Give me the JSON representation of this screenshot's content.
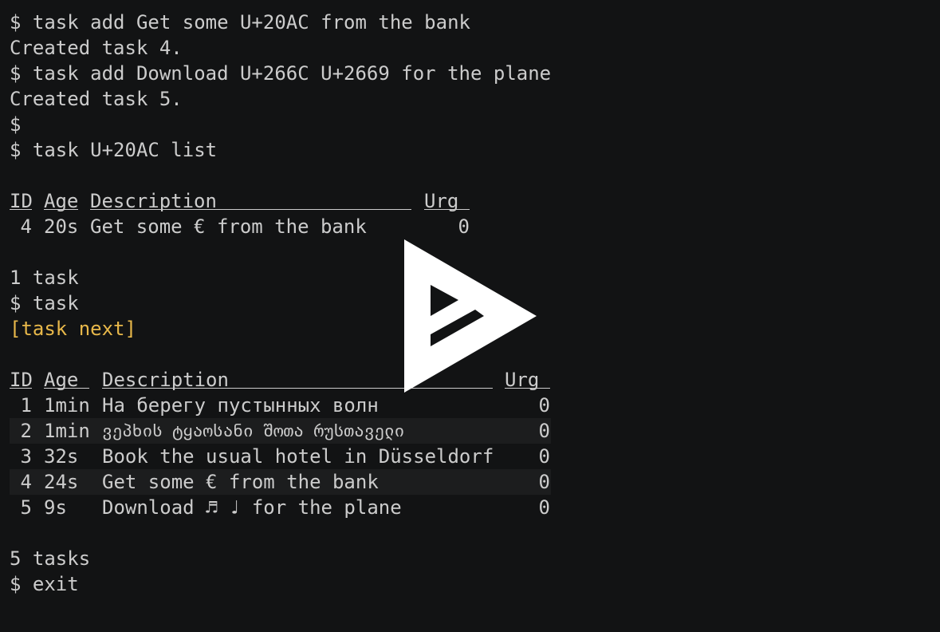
{
  "terminal": {
    "lines": {
      "l1": "$ task add Get some U+20AC from the bank",
      "l2": "Created task 4.",
      "l3": "$ task add Download U+266C U+2669 for the plane",
      "l4": "Created task 5.",
      "l5": "$",
      "l6": "$ task U+20AC list",
      "l11": "1 task",
      "l12": "$ task",
      "l13": "[task next]",
      "l21": "5 tasks",
      "l22": "$ exit"
    },
    "list_table": {
      "headers": {
        "id": "ID",
        "age": "Age",
        "description": "Description",
        "urg": "Urg"
      },
      "rows": [
        {
          "id": "4",
          "age": "20s",
          "description": "Get some € from the bank",
          "urg": "0"
        }
      ]
    },
    "next_table": {
      "headers": {
        "id": "ID",
        "age": "Age",
        "description": "Description",
        "urg": "Urg"
      },
      "rows": [
        {
          "id": "1",
          "age": "1min",
          "description": "На берегу пустынных волн",
          "urg": "0"
        },
        {
          "id": "2",
          "age": "1min",
          "description": "ვეპხის ტყაოსანი შოთა რუსთაველი",
          "urg": "0"
        },
        {
          "id": "3",
          "age": "32s",
          "description": "Book the usual hotel in Düsseldorf",
          "urg": "0"
        },
        {
          "id": "4",
          "age": "24s",
          "description": "Get some € from the bank",
          "urg": "0"
        },
        {
          "id": "5",
          "age": "9s",
          "description": "Download ♬ ♩ for the plane",
          "urg": "0"
        }
      ]
    }
  },
  "overlay": {
    "icon": "play-icon",
    "color": "#ffffff"
  },
  "colors": {
    "background": "#121314",
    "foreground": "#cccccc",
    "accent_yellow": "#e8b84a",
    "row_alt": "#1c1d1e"
  }
}
